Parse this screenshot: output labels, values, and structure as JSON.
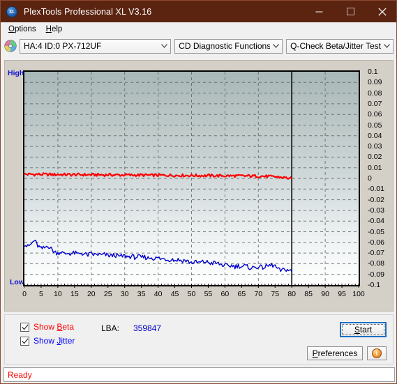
{
  "window": {
    "title": "PlexTools Professional XL V3.16",
    "icon": "xl-logo-icon",
    "minimize_label": "–",
    "maximize_label": "□",
    "close_label": "✕",
    "titlebar_color": "#5b2410"
  },
  "menubar": {
    "items": [
      {
        "label": "Options",
        "accel": "O"
      },
      {
        "label": "Help",
        "accel": "H"
      }
    ]
  },
  "toolbar": {
    "disc_icon": "optical-disc-icon",
    "drive_select": {
      "value": "HA:4 ID:0  PX-712UF",
      "options": [
        "HA:4 ID:0  PX-712UF"
      ]
    },
    "function_select": {
      "value": "CD Diagnostic Functions",
      "options": [
        "CD Diagnostic Functions"
      ]
    },
    "test_select": {
      "value": "Q-Check Beta/Jitter Test",
      "options": [
        "Q-Check Beta/Jitter Test"
      ]
    }
  },
  "controls": {
    "show_beta": {
      "label_pre": "Show ",
      "accel": "B",
      "label_post": "eta",
      "checked": true,
      "color": "#ff0000"
    },
    "show_jitter": {
      "label_pre": "Show ",
      "accel": "J",
      "label_post": "itter",
      "checked": true,
      "color": "#0000ff"
    },
    "lba_label": "LBA:",
    "lba_value": "359847",
    "start_button": {
      "pre": "",
      "accel": "S",
      "post": "tart"
    },
    "preferences_button": {
      "pre": "",
      "accel": "P",
      "post": "references"
    },
    "info_button": {
      "glyph": "i",
      "name": "info-icon"
    }
  },
  "statusbar": {
    "text": "Ready",
    "color": "#ff0000"
  },
  "chart_data": {
    "type": "line",
    "title": "Q-Check Beta/Jitter Test",
    "xlabel": "",
    "ylabel": "",
    "xlim": [
      0,
      100
    ],
    "ylim": [
      -0.1,
      0.1
    ],
    "grid": true,
    "legend_position": "external-checkboxes",
    "y_left_labels": [
      "High",
      "Low"
    ],
    "y_tick_labels": [
      "0.1",
      "0.09",
      "0.08",
      "0.07",
      "0.06",
      "0.05",
      "0.04",
      "0.03",
      "0.02",
      "0.01",
      "0",
      "-0.01",
      "-0.02",
      "-0.03",
      "-0.04",
      "-0.05",
      "-0.06",
      "-0.07",
      "-0.08",
      "-0.09",
      "-0.1"
    ],
    "y_ticks": [
      0.1,
      0.09,
      0.08,
      0.07,
      0.06,
      0.05,
      0.04,
      0.03,
      0.02,
      0.01,
      0,
      -0.01,
      -0.02,
      -0.03,
      -0.04,
      -0.05,
      -0.06,
      -0.07,
      -0.08,
      -0.09,
      -0.1
    ],
    "x_tick_labels": [
      "0",
      "5",
      "10",
      "15",
      "20",
      "25",
      "30",
      "35",
      "40",
      "45",
      "50",
      "55",
      "60",
      "65",
      "70",
      "75",
      "80",
      "85",
      "90",
      "95",
      "100"
    ],
    "x_ticks": [
      0,
      5,
      10,
      15,
      20,
      25,
      30,
      35,
      40,
      45,
      50,
      55,
      60,
      65,
      70,
      75,
      80,
      85,
      90,
      95,
      100
    ],
    "data_end_x": 80,
    "marker_line_x": 80,
    "series": [
      {
        "name": "Beta",
        "color": "#ff0000",
        "x": [
          0,
          1,
          2,
          3,
          4,
          5,
          6,
          7,
          8,
          9,
          10,
          11,
          12,
          13,
          14,
          15,
          16,
          17,
          18,
          19,
          20,
          21,
          22,
          23,
          24,
          25,
          26,
          27,
          28,
          29,
          30,
          31,
          32,
          33,
          34,
          35,
          36,
          37,
          38,
          39,
          40,
          41,
          42,
          43,
          44,
          45,
          46,
          47,
          48,
          49,
          50,
          51,
          52,
          53,
          54,
          55,
          56,
          57,
          58,
          59,
          60,
          61,
          62,
          63,
          64,
          65,
          66,
          67,
          68,
          69,
          70,
          71,
          72,
          73,
          74,
          75,
          76,
          77,
          78,
          79,
          80
        ],
        "y": [
          0.004,
          0.0038,
          0.004,
          0.0036,
          0.0039,
          0.0037,
          0.0038,
          0.0036,
          0.0037,
          0.0035,
          0.0037,
          0.0036,
          0.0035,
          0.0036,
          0.0034,
          0.0036,
          0.0035,
          0.0034,
          0.0035,
          0.0033,
          0.0035,
          0.0034,
          0.0033,
          0.0034,
          0.0032,
          0.0034,
          0.0033,
          0.0032,
          0.0033,
          0.0031,
          0.0033,
          0.0032,
          0.0031,
          0.0032,
          0.003,
          0.0032,
          0.003,
          0.0031,
          0.0029,
          0.0031,
          0.0029,
          0.003,
          0.0028,
          0.003,
          0.0028,
          0.0029,
          0.0027,
          0.0029,
          0.0027,
          0.0028,
          0.0026,
          0.0028,
          0.0026,
          0.0027,
          0.0025,
          0.0027,
          0.0025,
          0.0026,
          0.0024,
          0.0026,
          0.0024,
          0.0025,
          0.0023,
          0.0025,
          0.0023,
          0.0024,
          0.0022,
          0.0024,
          0.0021,
          0.0023,
          0.002,
          0.0022,
          0.0018,
          0.002,
          0.0015,
          0.0016,
          0.0012,
          0.001,
          0.0006,
          0.0002,
          -0.0002
        ]
      },
      {
        "name": "Jitter",
        "color": "#0000cc",
        "x": [
          0,
          1,
          2,
          3,
          4,
          5,
          6,
          7,
          8,
          9,
          10,
          11,
          12,
          13,
          14,
          15,
          16,
          17,
          18,
          19,
          20,
          21,
          22,
          23,
          24,
          25,
          26,
          27,
          28,
          29,
          30,
          31,
          32,
          33,
          34,
          35,
          36,
          37,
          38,
          39,
          40,
          41,
          42,
          43,
          44,
          45,
          46,
          47,
          48,
          49,
          50,
          51,
          52,
          53,
          54,
          55,
          56,
          57,
          58,
          59,
          60,
          61,
          62,
          63,
          64,
          65,
          66,
          67,
          68,
          69,
          70,
          71,
          72,
          73,
          74,
          75,
          76,
          77,
          78,
          79,
          80
        ],
        "y": [
          -0.0618,
          -0.064,
          -0.0618,
          -0.058,
          -0.0632,
          -0.066,
          -0.0652,
          -0.0628,
          -0.066,
          -0.069,
          -0.07,
          -0.0688,
          -0.0712,
          -0.07,
          -0.0706,
          -0.07,
          -0.071,
          -0.07,
          -0.0712,
          -0.0718,
          -0.0708,
          -0.0716,
          -0.0712,
          -0.072,
          -0.0714,
          -0.0722,
          -0.0726,
          -0.0718,
          -0.0728,
          -0.0732,
          -0.0726,
          -0.0736,
          -0.073,
          -0.074,
          -0.0734,
          -0.0742,
          -0.0738,
          -0.0748,
          -0.0742,
          -0.0752,
          -0.0746,
          -0.0758,
          -0.0752,
          -0.0764,
          -0.0756,
          -0.0768,
          -0.0762,
          -0.0772,
          -0.0768,
          -0.078,
          -0.079,
          -0.0784,
          -0.0792,
          -0.0786,
          -0.078,
          -0.0788,
          -0.0796,
          -0.079,
          -0.08,
          -0.081,
          -0.0818,
          -0.0824,
          -0.0816,
          -0.0826,
          -0.082,
          -0.0828,
          -0.0822,
          -0.0832,
          -0.084,
          -0.0834,
          -0.0826,
          -0.0836,
          -0.083,
          -0.082,
          -0.0812,
          -0.0822,
          -0.0858,
          -0.0866,
          -0.085,
          -0.086,
          -0.0874
        ]
      }
    ]
  }
}
